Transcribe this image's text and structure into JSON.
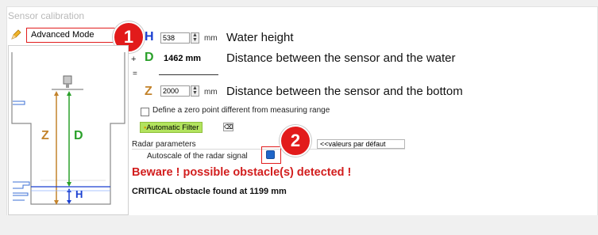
{
  "window": {
    "title": "Sensor calibration"
  },
  "mode_select": {
    "value": "Advanced Mode"
  },
  "badges": {
    "first": "1",
    "second": "2"
  },
  "diagram": {
    "label_z": "Z",
    "label_d": "D",
    "label_h": "H"
  },
  "water_height": {
    "letter": "H",
    "value": "538",
    "unit": "mm",
    "description": "Water height"
  },
  "distance_water": {
    "plus": "+",
    "letter": "D",
    "value": "1462 mm",
    "description": "Distance between the sensor and the water"
  },
  "equals": "=",
  "distance_bottom": {
    "letter": "Z",
    "value": "2000",
    "unit": "mm",
    "description": "Distance between the sensor and the bottom"
  },
  "zero_point": {
    "label": "Define a zero point different from measuring range",
    "checked": false
  },
  "auto_filter": {
    "label": "Automatic Filter",
    "reset_symbol": "⌫"
  },
  "radar": {
    "section_label": "Radar parameters",
    "autoscale_label": "Autoscale of the radar signal",
    "autoscale_checked": true,
    "defaults_button": "<<valeurs par défaut"
  },
  "warning": "Beware ! possible obstacle(s) detected !",
  "critical": "CRITICAL obstacle found at 1199 mm",
  "colors": {
    "highlight": "#e11d1d",
    "letter_h": "#1a3fd1",
    "letter_d": "#2aa02a",
    "letter_z": "#c3832b",
    "filter_bg": "#b2e35e"
  }
}
